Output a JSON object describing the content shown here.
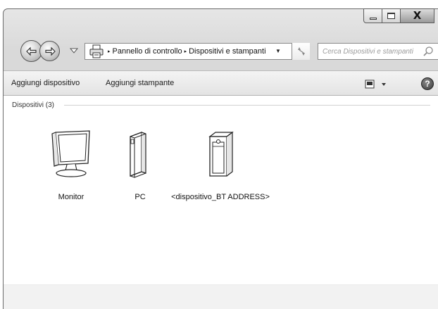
{
  "window": {
    "controls": {
      "close_glyph": "X"
    }
  },
  "navigation": {
    "breadcrumb": [
      "Pannello di controllo",
      "Dispositivi e stampanti"
    ],
    "breadcrumb_separator": "▸",
    "address_dropdown_glyph": "▼",
    "search_placeholder": "Cerca Dispositivi e stampanti"
  },
  "toolbar": {
    "add_device_label": "Aggiungi dispositivo",
    "add_printer_label": "Aggiungi stampante",
    "help_glyph": "?"
  },
  "content": {
    "group_title": "Dispositivi (3)",
    "devices": [
      {
        "label": "Monitor",
        "icon": "monitor-icon"
      },
      {
        "label": "PC",
        "icon": "pc-tower-icon"
      },
      {
        "label": "<dispositivo_BT ADDRESS>",
        "icon": "bluetooth-device-icon"
      }
    ]
  },
  "colors": {
    "chrome": "#dcdcdc",
    "border": "#6b6b6b",
    "content_bg": "#ffffff",
    "status_bg": "#f2f2f2"
  }
}
